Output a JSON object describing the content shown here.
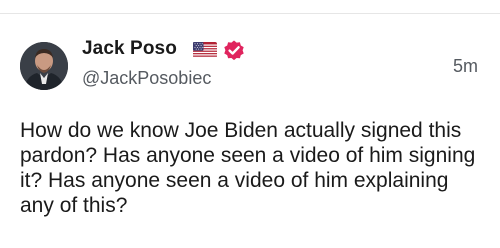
{
  "post": {
    "author": {
      "name": "Jack Poso",
      "handle": "@JackPosobiec",
      "flag_icon": "us-flag-icon",
      "verified_icon": "verified-badge-icon",
      "verified_color": "#e0245e"
    },
    "timestamp": "5m",
    "text": "How do we know Joe Biden actually signed this pardon? Has anyone seen a video of him signing it? Has anyone seen a video of him explaining any of this?"
  }
}
